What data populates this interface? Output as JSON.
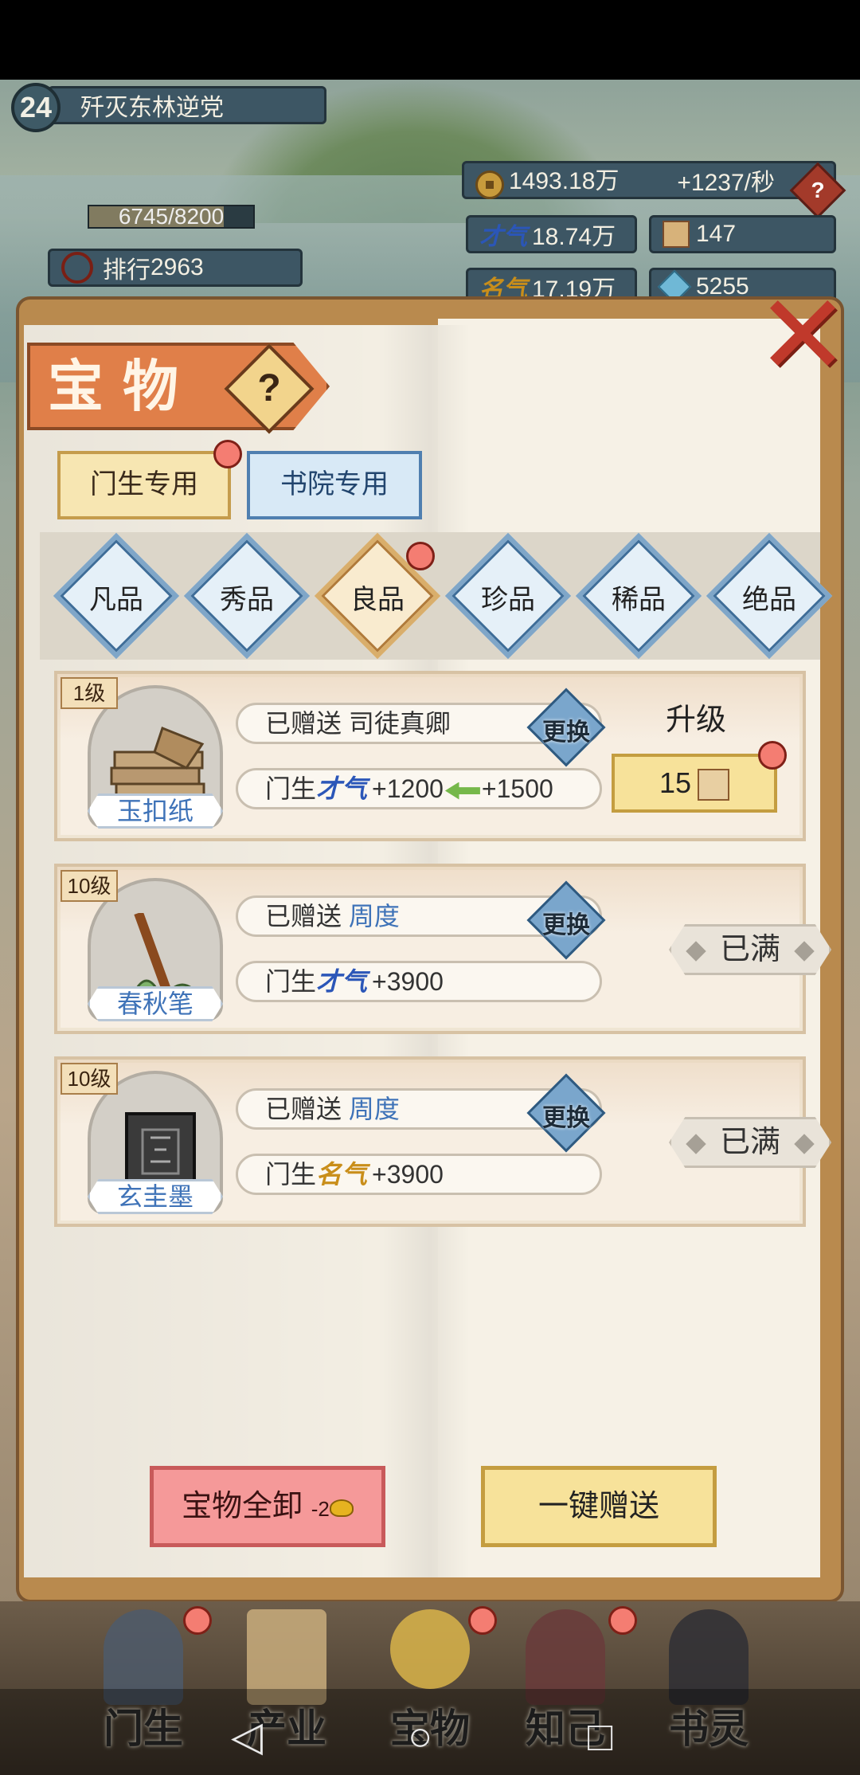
{
  "player": {
    "level": "24",
    "name": "歼灭东林逆党",
    "exp": "6745/8200",
    "exp_fraction": 0.82,
    "rank_label": "排行",
    "rank": "2963"
  },
  "resources": {
    "coins": "1493.18万",
    "coin_rate": "+1237/秒",
    "talent_label": "才气",
    "talent": "18.74万",
    "gold_count": "147",
    "fame_label": "名气",
    "fame": "17.19万",
    "gem_count": "5255"
  },
  "panel": {
    "title": "宝物",
    "help_symbol": "?",
    "close_symbol": "✕",
    "tabs": [
      {
        "label": "门生专用",
        "active": true
      },
      {
        "label": "书院专用",
        "active": false
      }
    ],
    "rarities": [
      "凡品",
      "秀品",
      "良品",
      "珍品",
      "稀品",
      "绝品"
    ],
    "selected_rarity": "良品"
  },
  "items": [
    {
      "level": "1级",
      "name": "玉扣纸",
      "gift_prefix": "已赠送",
      "gift_target": "司徒真卿",
      "swap_label": "更换",
      "bonus_prefix": "门生",
      "bonus_stat": "才气",
      "bonus_value": "+1200",
      "bonus_next": "+1500",
      "upgrade_label": "升级",
      "upgrade_cost": "15"
    },
    {
      "level": "10级",
      "name": "春秋笔",
      "gift_prefix": "已赠送",
      "gift_target": "周度",
      "swap_label": "更换",
      "bonus_prefix": "门生",
      "bonus_stat": "才气",
      "bonus_value": "+3900",
      "status": "已满"
    },
    {
      "level": "10级",
      "name": "玄圭墨",
      "gift_prefix": "已赠送",
      "gift_target": "周度",
      "swap_label": "更换",
      "bonus_prefix": "门生",
      "bonus_stat": "名气",
      "bonus_value": "+3900",
      "status": "已满"
    }
  ],
  "actions": {
    "unload_label": "宝物全卸",
    "unload_cost": "-2",
    "gift_all_label": "一键赠送"
  },
  "nav": [
    "门生",
    "产业",
    "宝物",
    "知己",
    "书灵"
  ],
  "system_nav": {
    "back": "◁",
    "home": "○",
    "recent": "□"
  },
  "colors": {
    "accent_red": "#f47d72",
    "title_orange": "#e07f49",
    "highlight_blue": "#3f73b8"
  }
}
